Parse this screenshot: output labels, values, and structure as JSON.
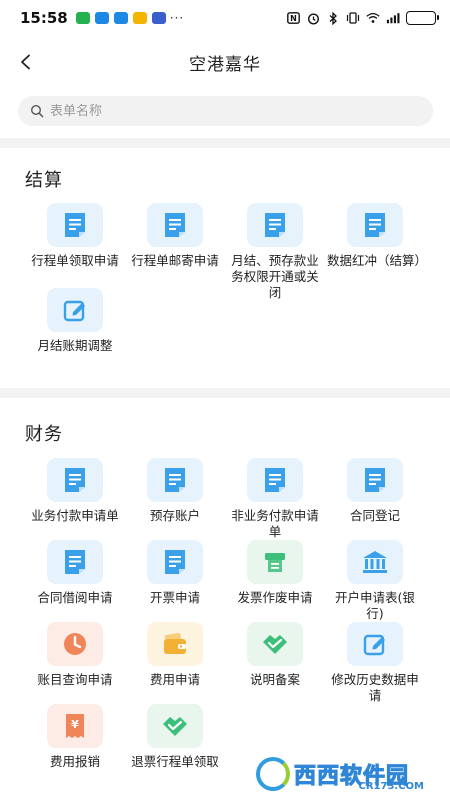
{
  "status_bar": {
    "time": "15:58",
    "app_icons": [
      "wechat-icon",
      "messenger-icon",
      "chat-icon",
      "reader-app-icon",
      "media-app-icon"
    ],
    "app_colors": [
      "#22b14c",
      "#1e88e5",
      "#1e88e5",
      "#f5b400",
      "#3a5fcd"
    ],
    "overflow": "···",
    "right_icons": [
      "nfc-icon",
      "alarm-icon",
      "bluetooth-icon",
      "vibrate-icon",
      "wifi-icon",
      "signal-icon",
      "battery-icon"
    ],
    "battery_level": 0.18
  },
  "nav": {
    "title": "空港嘉华"
  },
  "search": {
    "placeholder": "表单名称"
  },
  "sections": [
    {
      "title": "结算",
      "items": [
        {
          "label": "行程单领取申请",
          "icon": "document-icon",
          "tone": "blue"
        },
        {
          "label": "行程单邮寄申请",
          "icon": "document-icon",
          "tone": "blue"
        },
        {
          "label": "月结、预存款业务权限开通或关闭",
          "icon": "document-icon",
          "tone": "blue"
        },
        {
          "label": "数据红冲（结算）",
          "icon": "document-icon",
          "tone": "blue"
        },
        {
          "label": "月结账期调整",
          "icon": "edit-icon",
          "tone": "blue"
        }
      ]
    },
    {
      "title": "财务",
      "items": [
        {
          "label": "业务付款申请单",
          "icon": "document-icon",
          "tone": "blue"
        },
        {
          "label": "预存账户",
          "icon": "document-icon",
          "tone": "blue"
        },
        {
          "label": "非业务付款申请单",
          "icon": "document-icon",
          "tone": "blue"
        },
        {
          "label": "合同登记",
          "icon": "document-icon",
          "tone": "blue"
        },
        {
          "label": "合同借阅申请",
          "icon": "document-icon",
          "tone": "blue"
        },
        {
          "label": "开票申请",
          "icon": "document-icon",
          "tone": "blue"
        },
        {
          "label": "发票作废申请",
          "icon": "printer-icon",
          "tone": "green"
        },
        {
          "label": "开户申请表(银行)",
          "icon": "bank-icon",
          "tone": "blue"
        },
        {
          "label": "账目查询申请",
          "icon": "clock-icon",
          "tone": "orange"
        },
        {
          "label": "费用申请",
          "icon": "wallet-icon",
          "tone": "yellow"
        },
        {
          "label": "说明备案",
          "icon": "handshake-icon",
          "tone": "green"
        },
        {
          "label": "修改历史数据申请",
          "icon": "edit-icon",
          "tone": "blue"
        },
        {
          "label": "费用报销",
          "icon": "receipt-icon",
          "tone": "orange"
        },
        {
          "label": "退票行程单领取",
          "icon": "handshake-icon",
          "tone": "green"
        }
      ]
    }
  ],
  "colors": {
    "blue_tile": "#e6f3fd",
    "blue_icon": "#3aa0ea",
    "green_tile": "#e8f6ee",
    "green_icon": "#3cbf7a",
    "orange_tile": "#fdece6",
    "orange_icon": "#f0855a",
    "yellow_tile": "#fdf4e0",
    "yellow_icon": "#f2b035"
  },
  "watermark": {
    "text": "西西软件园",
    "sub": "CR173.COM"
  }
}
